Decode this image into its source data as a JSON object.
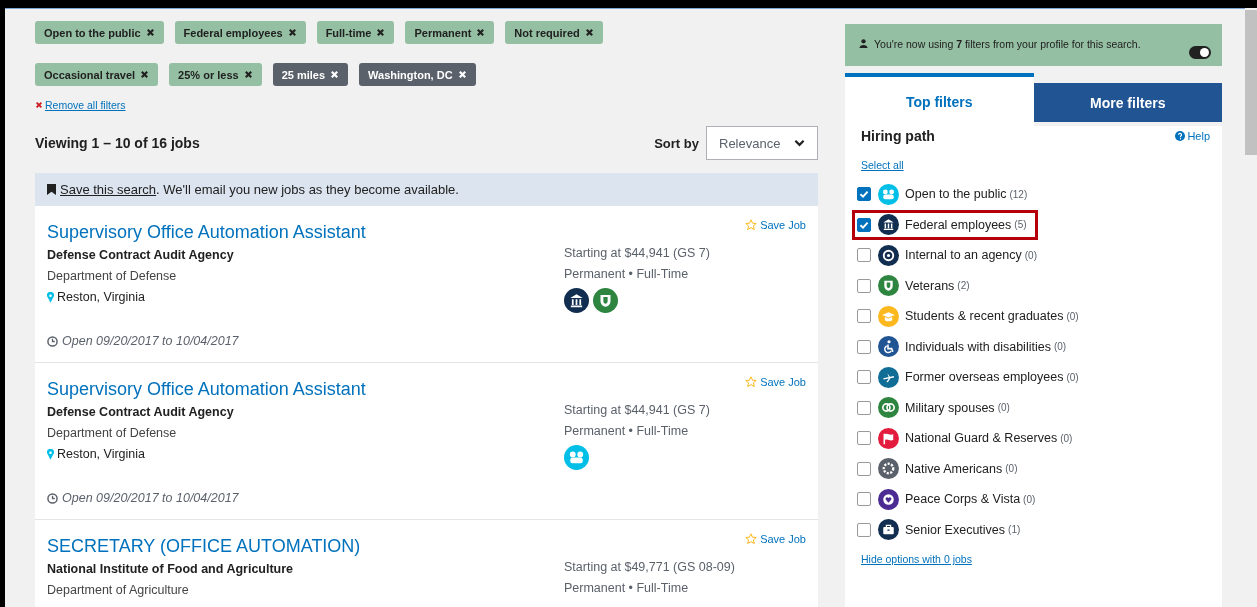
{
  "filter_chips": [
    {
      "label": "Open to the public",
      "kind": "profile"
    },
    {
      "label": "Federal employees",
      "kind": "profile"
    },
    {
      "label": "Full-time",
      "kind": "profile"
    },
    {
      "label": "Permanent",
      "kind": "profile"
    },
    {
      "label": "Not required",
      "kind": "profile"
    },
    {
      "label": "Occasional travel",
      "kind": "profile"
    },
    {
      "label": "25% or less",
      "kind": "profile"
    },
    {
      "label": "25 miles",
      "kind": "location"
    },
    {
      "label": "Washington, DC",
      "kind": "location"
    }
  ],
  "remove_all": "Remove all filters",
  "results": {
    "summary": "Viewing 1 – 10 of 16 jobs",
    "sort_label": "Sort by",
    "sort_value": "Relevance"
  },
  "save_search": {
    "link": "Save this search",
    "text": ". We'll email you new jobs as they become available."
  },
  "jobs": [
    {
      "title": "Supervisory Office Automation Assistant",
      "agency": "Defense Contract Audit Agency",
      "department": "Department of Defense",
      "location": "Reston, Virginia",
      "save": "Save Job",
      "salary": "Starting at $44,941 (GS 7)",
      "schedule": "Permanent • Full-Time",
      "badges": [
        {
          "kind": "federal",
          "color": "#112e51"
        },
        {
          "kind": "veterans",
          "color": "#2e8540"
        }
      ],
      "dates": "Open 09/20/2017 to 10/04/2017"
    },
    {
      "title": "Supervisory Office Automation Assistant",
      "agency": "Defense Contract Audit Agency",
      "department": "Department of Defense",
      "location": "Reston, Virginia",
      "save": "Save Job",
      "salary": "Starting at $44,941 (GS 7)",
      "schedule": "Permanent • Full-Time",
      "badges": [
        {
          "kind": "public",
          "color": "#02bfe7"
        }
      ],
      "dates": "Open 09/20/2017 to 10/04/2017"
    },
    {
      "title": "SECRETARY (OFFICE AUTOMATION)",
      "agency": "National Institute of Food and Agriculture",
      "department": "Department of Agriculture",
      "save": "Save Job",
      "salary": "Starting at $49,771 (GS 08-09)",
      "schedule": "Permanent • Full-Time"
    }
  ],
  "profile_banner": {
    "text": "You're now using **7** filters from your profile for this search.",
    "on": true
  },
  "tabs": [
    {
      "label": "Top filters",
      "selected": true
    },
    {
      "label": "More filters",
      "selected": false
    }
  ],
  "hiring_path": {
    "title": "Hiring path",
    "help": "Help",
    "select_all": "Select all",
    "hide_link": "Hide options with 0 jobs",
    "items": [
      {
        "label": "Open to the public",
        "count": "(12)",
        "checked": true,
        "highlighted": false,
        "kind": "public",
        "color": "#02bfe7"
      },
      {
        "label": "Federal employees",
        "count": "(5)",
        "checked": true,
        "highlighted": true,
        "kind": "federal",
        "color": "#112e51"
      },
      {
        "label": "Internal to an agency",
        "count": "(0)",
        "checked": false,
        "highlighted": false,
        "kind": "internal",
        "color": "#112e51"
      },
      {
        "label": "Veterans",
        "count": "(2)",
        "checked": false,
        "highlighted": false,
        "kind": "veterans",
        "color": "#2e8540"
      },
      {
        "label": "Students & recent graduates",
        "count": "(0)",
        "checked": false,
        "highlighted": false,
        "kind": "students",
        "color": "#fdb81e"
      },
      {
        "label": "Individuals with disabilities",
        "count": "(0)",
        "checked": false,
        "highlighted": false,
        "kind": "disabilities",
        "color": "#205493"
      },
      {
        "label": "Former overseas employees",
        "count": "(0)",
        "checked": false,
        "highlighted": false,
        "kind": "overseas",
        "color": "#0f6d96"
      },
      {
        "label": "Military spouses",
        "count": "(0)",
        "checked": false,
        "highlighted": false,
        "kind": "spouses",
        "color": "#2e8540"
      },
      {
        "label": "National Guard & Reserves",
        "count": "(0)",
        "checked": false,
        "highlighted": false,
        "kind": "guard",
        "color": "#e31c3d"
      },
      {
        "label": "Native Americans",
        "count": "(0)",
        "checked": false,
        "highlighted": false,
        "kind": "native",
        "color": "#5b616b"
      },
      {
        "label": "Peace Corps & Vista",
        "count": "(0)",
        "checked": false,
        "highlighted": false,
        "kind": "peace",
        "color": "#4c2c92"
      },
      {
        "label": "Senior Executives",
        "count": "(1)",
        "checked": false,
        "highlighted": false,
        "kind": "senior",
        "color": "#112e51"
      }
    ]
  }
}
